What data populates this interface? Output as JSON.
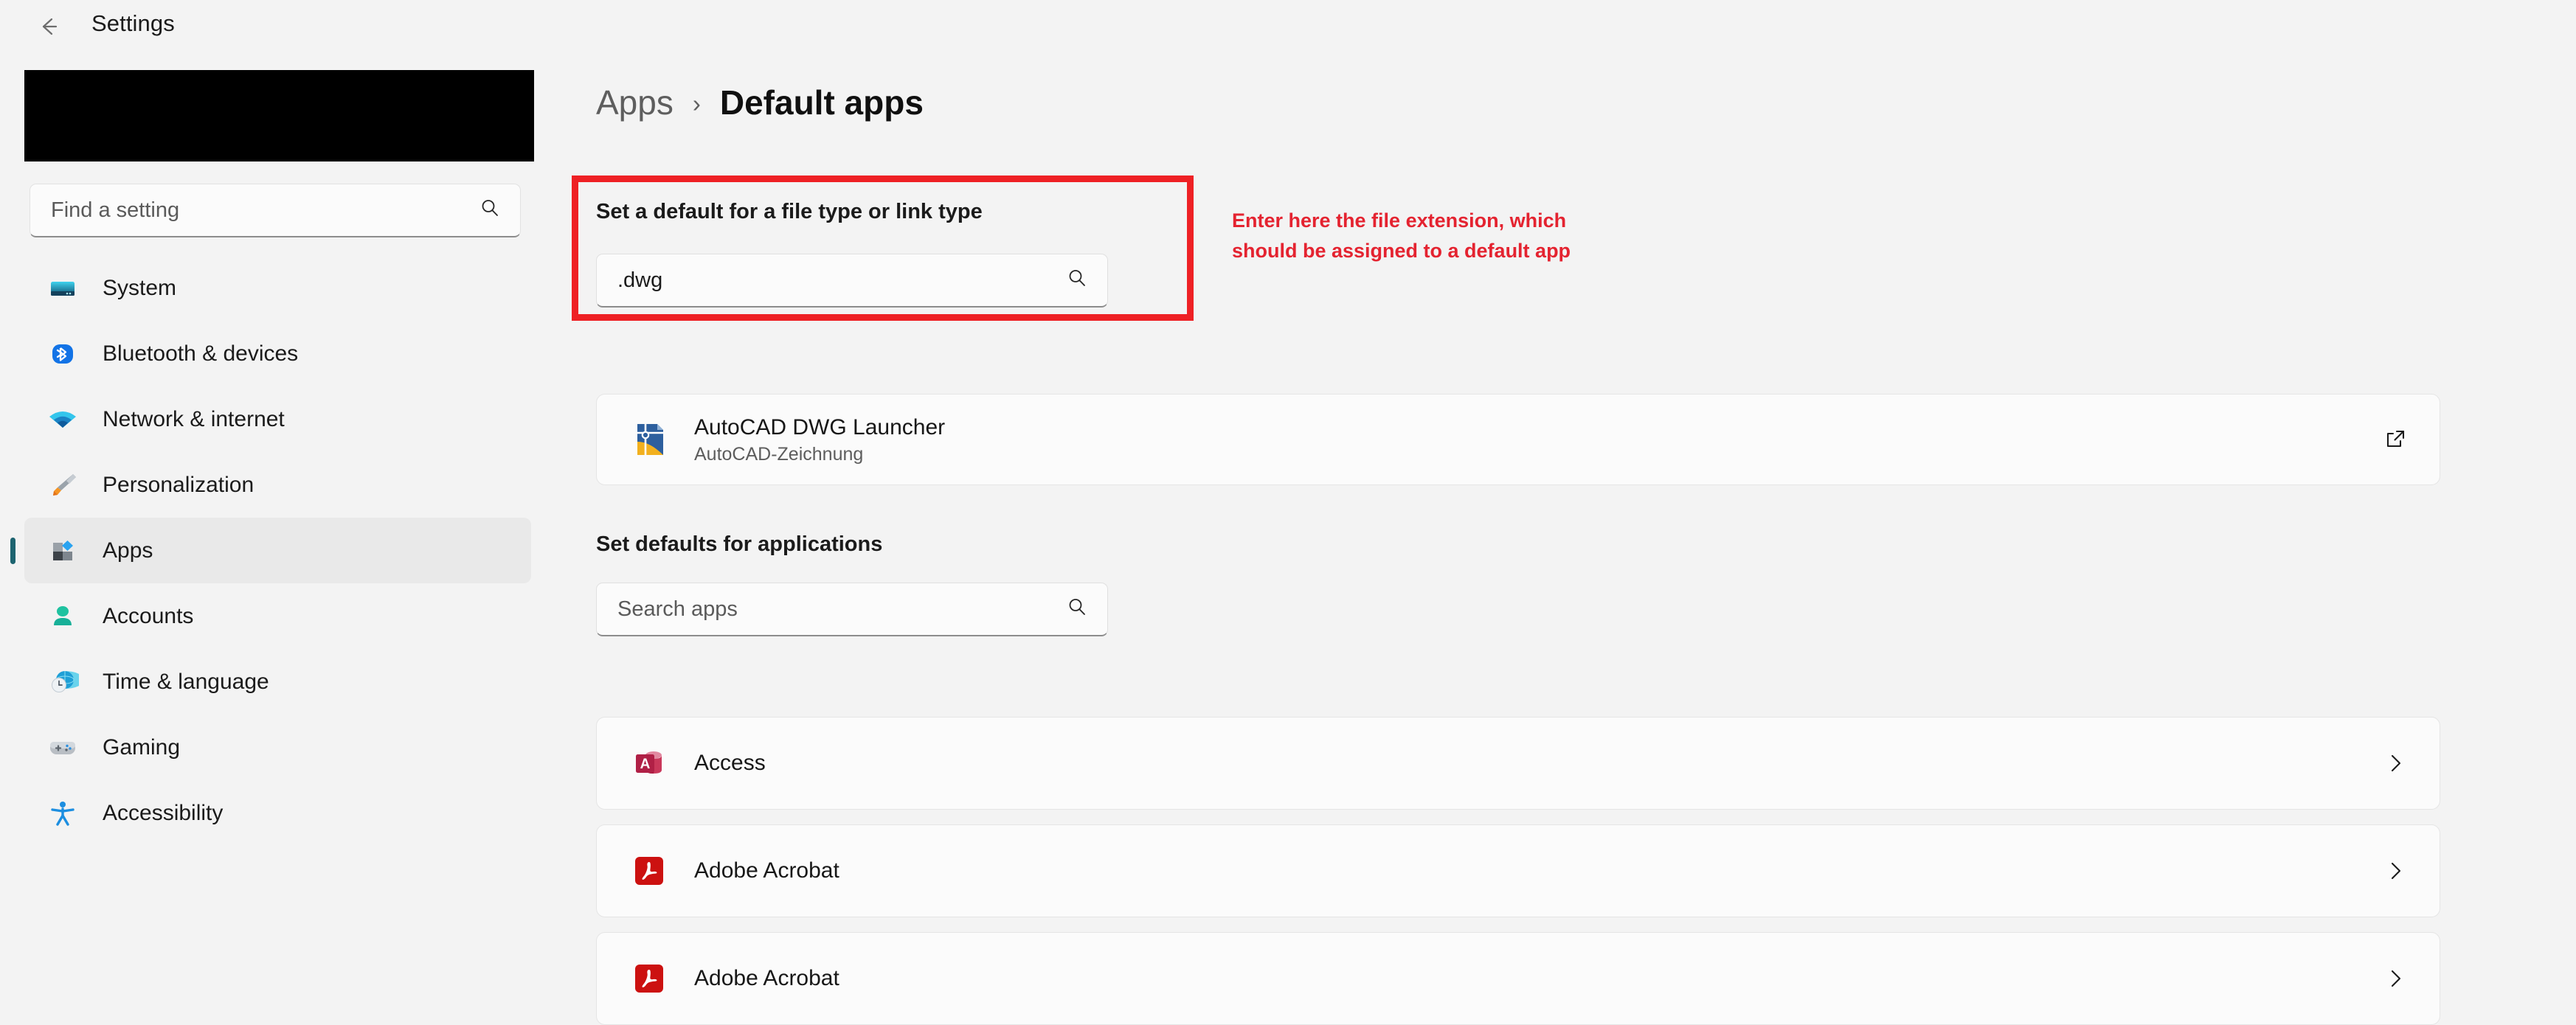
{
  "window": {
    "title": "Settings",
    "back_icon": "back-arrow-icon"
  },
  "sidebar": {
    "search": {
      "placeholder": "Find a setting",
      "icon": "search-icon"
    },
    "items": [
      {
        "label": "System",
        "icon": "monitor-icon",
        "selected": false
      },
      {
        "label": "Bluetooth & devices",
        "icon": "bluetooth-icon",
        "selected": false
      },
      {
        "label": "Network & internet",
        "icon": "wifi-icon",
        "selected": false
      },
      {
        "label": "Personalization",
        "icon": "paintbrush-icon",
        "selected": false
      },
      {
        "label": "Apps",
        "icon": "apps-icon",
        "selected": true
      },
      {
        "label": "Accounts",
        "icon": "person-icon",
        "selected": false
      },
      {
        "label": "Time & language",
        "icon": "clock-globe-icon",
        "selected": false
      },
      {
        "label": "Gaming",
        "icon": "gamepad-icon",
        "selected": false
      },
      {
        "label": "Accessibility",
        "icon": "accessibility-icon",
        "selected": false
      }
    ]
  },
  "main": {
    "breadcrumb": {
      "parent": "Apps",
      "separator": "›",
      "current": "Default apps"
    },
    "filetype_section": {
      "heading": "Set a default for a file type or link type",
      "search_value": ".dwg",
      "search_icon": "search-icon",
      "result": {
        "title": "AutoCAD DWG Launcher",
        "subtitle": "AutoCAD-Zeichnung",
        "icon": "autocad-dwg-icon",
        "action_icon": "open-external-icon"
      }
    },
    "defaults_section": {
      "heading": "Set defaults for applications",
      "search_placeholder": "Search apps",
      "search_icon": "search-icon",
      "apps": [
        {
          "name": "Access",
          "icon": "ms-access-icon",
          "action_icon": "chevron-right-icon"
        },
        {
          "name": "Adobe Acrobat",
          "icon": "adobe-acrobat-icon",
          "action_icon": "chevron-right-icon"
        },
        {
          "name": "Adobe Acrobat",
          "icon": "adobe-acrobat-icon",
          "action_icon": "chevron-right-icon"
        }
      ]
    },
    "annotation": {
      "text": "Enter here the file extension, which should be assigned to a default app",
      "color": "#e42330"
    }
  },
  "colors": {
    "page_background": "#f3f3f3",
    "card_background": "#fbfbfb",
    "accent_selected": "#1d6470",
    "annotation_red": "#ee2024"
  }
}
